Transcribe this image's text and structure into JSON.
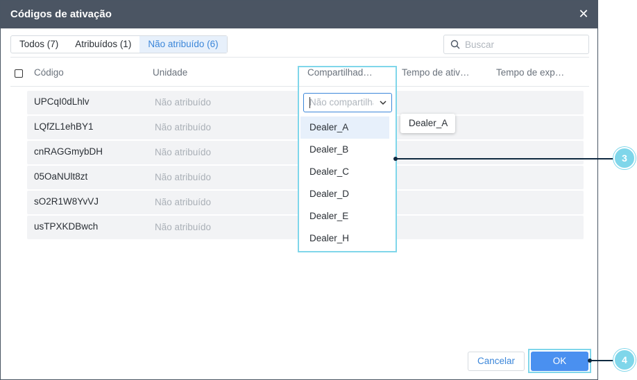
{
  "dialog": {
    "title": "Códigos de ativação"
  },
  "tabs": [
    {
      "label": "Todos (7)"
    },
    {
      "label": "Atribuídos (1)"
    },
    {
      "label": "Não atribuído (6)"
    }
  ],
  "search": {
    "placeholder": "Buscar"
  },
  "table": {
    "headers": [
      "Código",
      "Unidade",
      "Compartilhad…",
      "Tempo de ativ…",
      "Tempo de exp…"
    ],
    "rows": [
      {
        "code": "UPCqI0dLhlv",
        "unit": "Não atribuído"
      },
      {
        "code": "LQfZL1ehBY1",
        "unit": "Não atribuído"
      },
      {
        "code": "cnRAGGmybDH",
        "unit": "Não atribuído"
      },
      {
        "code": "05OaNUlt8zt",
        "unit": "Não atribuído"
      },
      {
        "code": "sO2R1W8YvVJ",
        "unit": "Não atribuído"
      },
      {
        "code": "usTPXKDBwch",
        "unit": "Não atribuído"
      }
    ]
  },
  "share_select": {
    "placeholder": "Não compartilhado",
    "options": [
      "Dealer_A",
      "Dealer_B",
      "Dealer_C",
      "Dealer_D",
      "Dealer_E",
      "Dealer_H"
    ],
    "highlighted": "Dealer_A",
    "tooltip": "Dealer_A"
  },
  "callouts": [
    "3",
    "4"
  ],
  "footer": {
    "cancel_label": "Cancelar",
    "ok_label": "OK"
  },
  "colors": {
    "titlebar": "#4b5563",
    "accent": "#3b86d9",
    "primary_button": "#4a90f0",
    "callout": "#7fd6ea"
  }
}
